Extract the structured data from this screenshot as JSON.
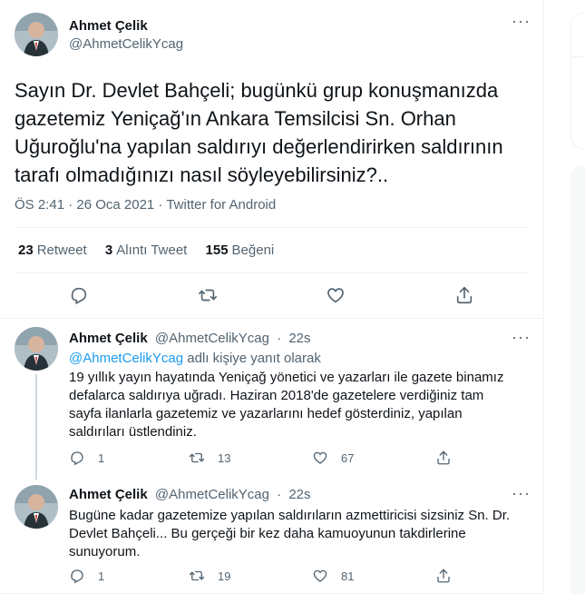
{
  "main_tweet": {
    "name": "Ahmet Çelik",
    "handle": "@AhmetCelikYcag",
    "text": "Sayın Dr. Devlet Bahçeli; bugünkü grup konuşmanızda gazetemiz Yeniçağ'ın Ankara Temsilcisi Sn. Orhan Uğuroğlu'na yapılan saldırıyı değerlendirirken saldırının tarafı olmadığınızı nasıl söyleyebilirsiniz?..",
    "meta": "ÖS 2:41 · 26 Oca 2021 · Twitter for Android",
    "stats": [
      {
        "count": "23",
        "label": "Retweet"
      },
      {
        "count": "3",
        "label": "Alıntı Tweet"
      },
      {
        "count": "155",
        "label": "Beğeni"
      }
    ],
    "icons": [
      "reply-icon",
      "retweet-icon",
      "like-icon",
      "share-icon"
    ]
  },
  "replies": [
    {
      "name": "Ahmet Çelik",
      "handle": "@AhmetCelikYcag",
      "time": "22s",
      "replying_to": "@AhmetCelikYcag",
      "replying_suffix": "adlı kişiye yanıt olarak",
      "text": "19 yıllık yayın hayatında Yeniçağ yönetici ve yazarları ile gazete binamız defalarca saldırıya uğradı. Haziran 2018'de  gazetelere verdiğiniz tam sayfa ilanlarla gazetemiz ve yazarlarını hedef gösterdiniz, yapılan saldırıları üstlendiniz.",
      "replies": "1",
      "retweets": "13",
      "likes": "67"
    },
    {
      "name": "Ahmet Çelik",
      "handle": "@AhmetCelikYcag",
      "time": "22s",
      "text": "Bugüne kadar gazetemize yapılan saldırıların azmettiricisi sizsiniz Sn. Dr. Devlet Bahçeli... Bu gerçeği bir kez daha kamuoyunun takdirlerine sunuyorum.",
      "replies": "1",
      "retweets": "19",
      "likes": "81"
    }
  ],
  "colors": {
    "text": "#0f1419",
    "secondary": "#536471",
    "link": "#1d9bf0",
    "border": "#eff3f4"
  }
}
